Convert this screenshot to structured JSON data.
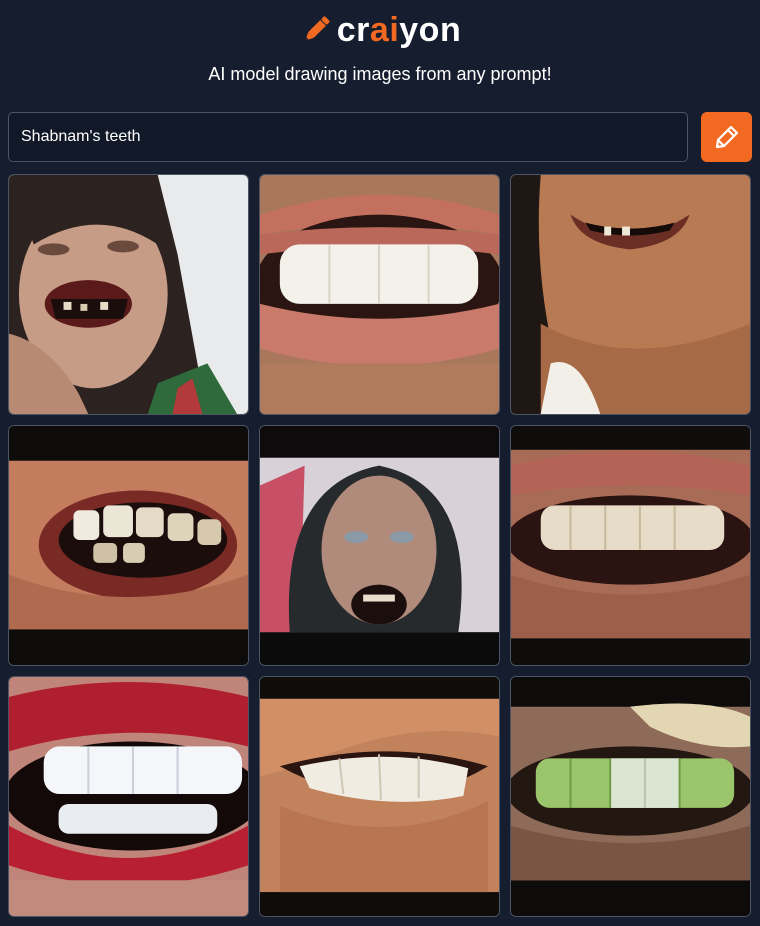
{
  "app": {
    "logo_prefix": "cr",
    "logo_accent": "ai",
    "logo_suffix": "yon",
    "tagline": "AI model drawing images from any prompt!",
    "logo_icon": "pencil-icon"
  },
  "colors": {
    "background": "#161d2e",
    "accent": "#f26a21",
    "input_background": "#111827",
    "border": "#4b5563"
  },
  "prompt": {
    "value": "Shabnam's teeth",
    "button_icon": "pencil-icon"
  },
  "results": {
    "count": 9,
    "images": [
      {
        "subject": "woman holding face, darkened teeth"
      },
      {
        "subject": "close-up smile, white front teeth"
      },
      {
        "subject": "smiling chin with gapped teeth"
      },
      {
        "subject": "close-up mouth, crooked teeth"
      },
      {
        "subject": "woman in hood with dark teeth"
      },
      {
        "subject": "close-up smile, stained teeth"
      },
      {
        "subject": "red lips, white teeth"
      },
      {
        "subject": "open mouth, upper teeth"
      },
      {
        "subject": "close-up green-tinted teeth"
      }
    ]
  }
}
